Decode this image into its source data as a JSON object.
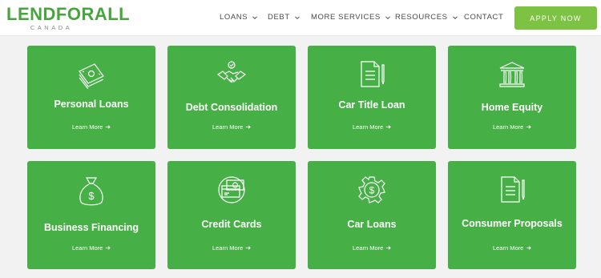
{
  "brand": {
    "logo_main": "LENDFORALL",
    "logo_sub": "CANADA",
    "accent": "#46b046",
    "button_color": "#7dc242"
  },
  "nav": {
    "items": [
      {
        "label": "LOANS",
        "dropdown": true
      },
      {
        "label": "DEBT",
        "dropdown": true
      },
      {
        "label": "MORE SERVICES",
        "dropdown": true
      },
      {
        "label": "RESOURCES",
        "dropdown": true
      },
      {
        "label": "CONTACT",
        "dropdown": false
      }
    ],
    "apply_label": "APPLY NOW"
  },
  "cards": [
    {
      "title": "Personal Loans",
      "icon": "money-stack-icon",
      "link": "Learn More"
    },
    {
      "title": "Debt Consolidation",
      "icon": "handshake-icon",
      "link": "Learn More"
    },
    {
      "title": "Car Title Loan",
      "icon": "document-pen-icon",
      "link": "Learn More"
    },
    {
      "title": "Home Equity",
      "icon": "bank-building-icon",
      "link": "Learn More"
    },
    {
      "title": "Business Financing",
      "icon": "money-bag-icon",
      "link": "Learn More"
    },
    {
      "title": "Credit Cards",
      "icon": "credit-card-icon",
      "link": "Learn More"
    },
    {
      "title": "Car Loans",
      "icon": "gear-dollar-icon",
      "link": "Learn More"
    },
    {
      "title": "Consumer Proposals",
      "icon": "document-pen-icon",
      "link": "Learn More"
    }
  ]
}
